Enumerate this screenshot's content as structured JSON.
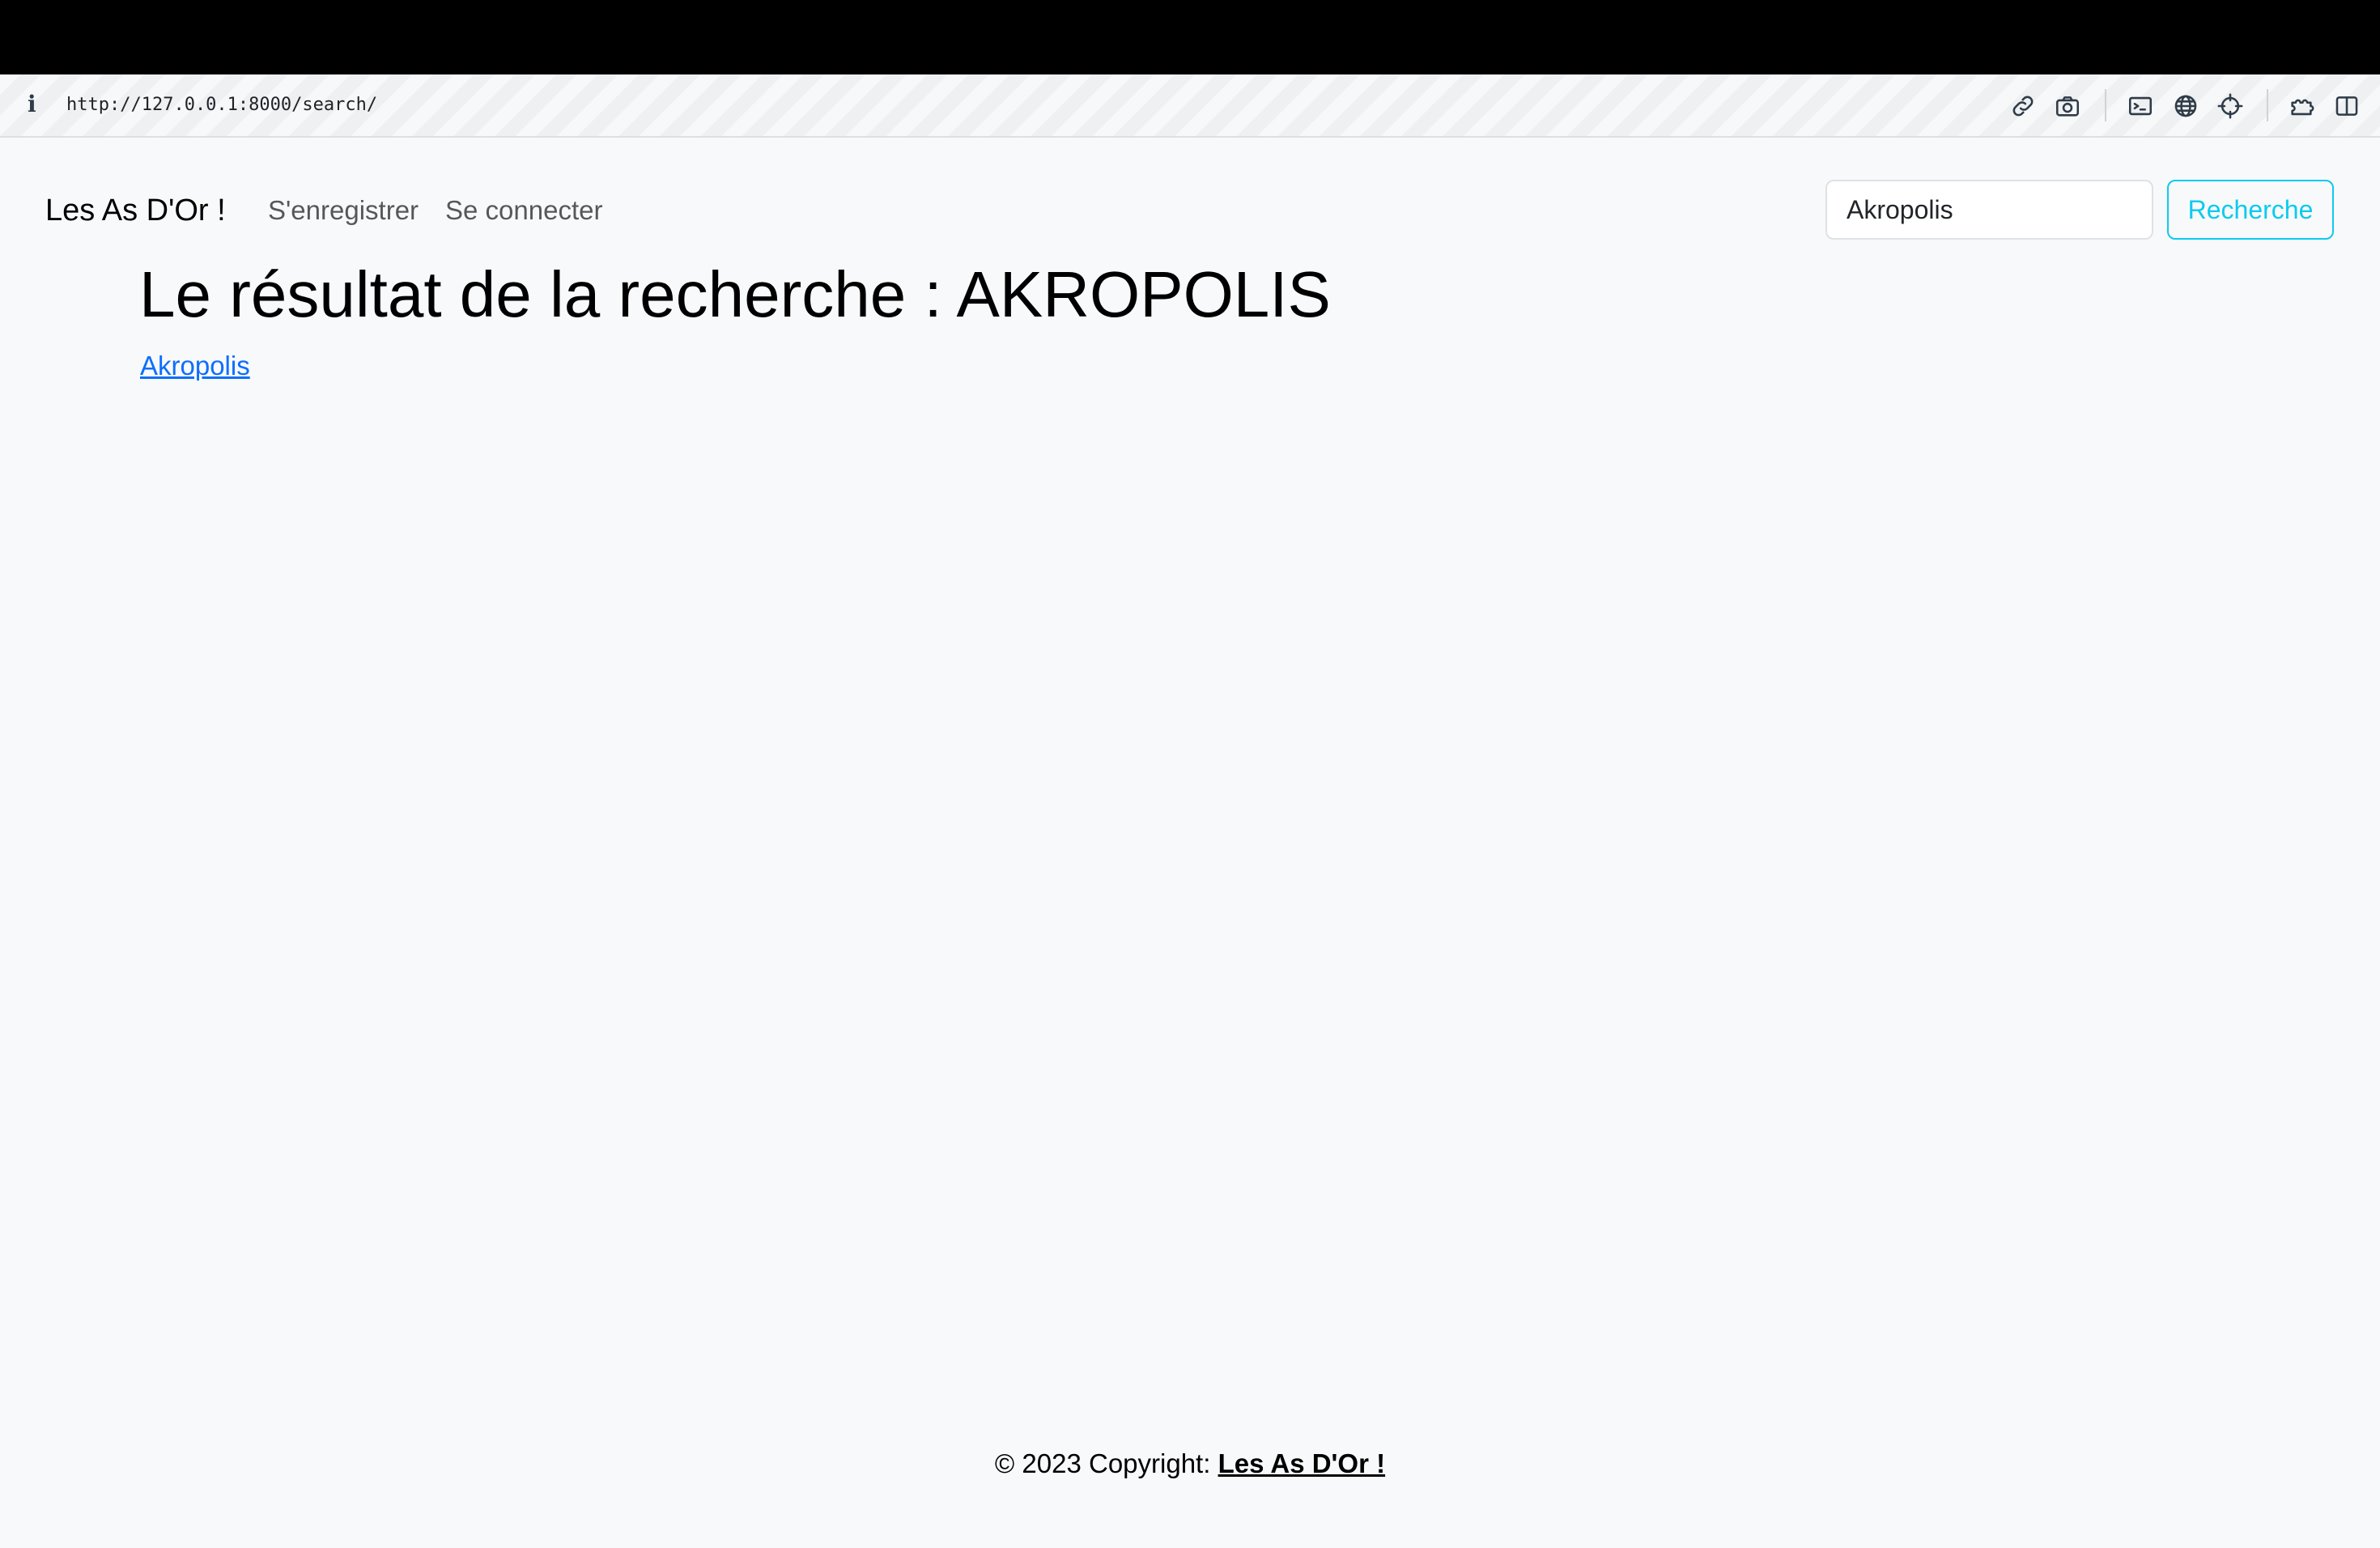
{
  "browser": {
    "url": "http://127.0.0.1:8000/search/",
    "icons": [
      "info-icon",
      "link-icon",
      "camera-icon",
      "terminal-icon",
      "globe-icon",
      "crosshair-icon",
      "extensions-icon",
      "sidebar-icon"
    ]
  },
  "navbar": {
    "brand": "Les As D'Or !",
    "links": [
      "S'enregistrer",
      "Se connecter"
    ],
    "search": {
      "value": "Akropolis",
      "button_label": "Recherche"
    }
  },
  "main": {
    "title": "Le résultat de la recherche : AKROPOLIS",
    "results": [
      "Akropolis"
    ]
  },
  "footer": {
    "prefix": "© 2023 Copyright: ",
    "link_text": "Les As D'Or !"
  },
  "colors": {
    "background": "#f8f9fa",
    "link": "#0d6efd",
    "info_button": "#0dcaf0"
  }
}
